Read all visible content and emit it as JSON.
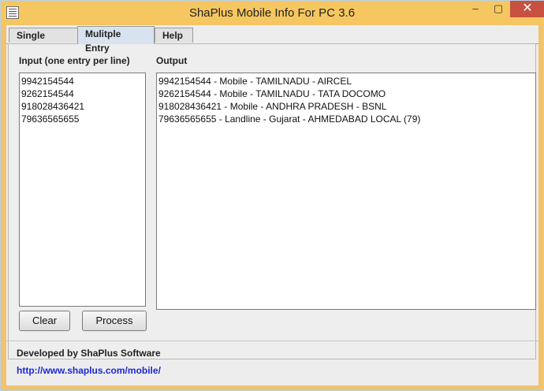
{
  "window": {
    "title": "ShaPlus Mobile Info For PC 3.6",
    "controls": {
      "minimize": "–",
      "maximize": "▢",
      "close": "✕"
    }
  },
  "tabs": [
    {
      "label": "Single Entry"
    },
    {
      "label": "Mulitple Entry",
      "active": true
    },
    {
      "label": "Help"
    }
  ],
  "input": {
    "label": "Input (one entry per line)",
    "lines": [
      "9942154544",
      "9262154544",
      "918028436421",
      "79636565655"
    ]
  },
  "output": {
    "label": "Output",
    "lines": [
      "9942154544 - Mobile - TAMILNADU - AIRCEL",
      "9262154544 - Mobile - TAMILNADU - TATA DOCOMO",
      "918028436421 - Mobile - ANDHRA PRADESH - BSNL",
      "79636565655 - Landline - Gujarat - AHMEDABAD LOCAL (79)"
    ]
  },
  "buttons": {
    "clear": "Clear",
    "process": "Process"
  },
  "footer": {
    "developer": "Developed by ShaPlus Software",
    "link": "http://www.shaplus.com/mobile/"
  },
  "colors": {
    "titlebar": "#f6c760",
    "link": "#1b27d6",
    "close": "#c7503f"
  },
  "icons": {
    "app": "app-document-icon"
  }
}
